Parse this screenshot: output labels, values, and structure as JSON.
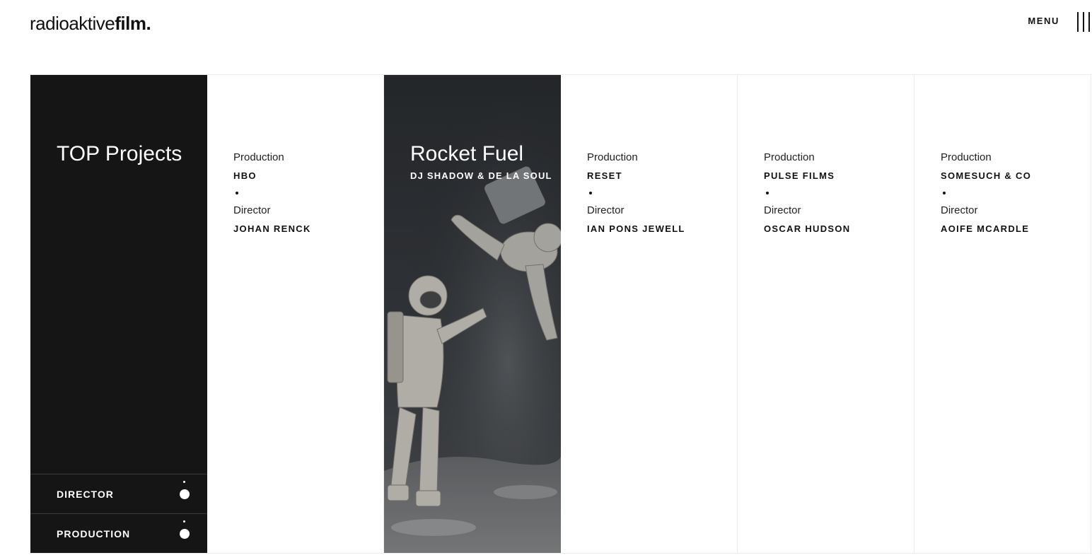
{
  "header": {
    "logo_light": "radioaktive",
    "logo_bold": "film.",
    "menu_label": "MENU"
  },
  "intro": {
    "title": "TOP Projects",
    "filters": [
      {
        "label": "DIRECTOR"
      },
      {
        "label": "PRODUCTION"
      }
    ]
  },
  "projects": [
    {
      "production_label": "Production",
      "production": "HBO",
      "director_label": "Director",
      "director": "JOHAN RENCK"
    },
    {
      "title": "Rocket Fuel",
      "subtitle": "DJ SHADOW & DE LA SOUL"
    },
    {
      "production_label": "Production",
      "production": "RESET",
      "director_label": "Director",
      "director": "IAN PONS JEWELL"
    },
    {
      "production_label": "Production",
      "production": "PULSE FILMS",
      "director_label": "Director",
      "director": "OSCAR HUDSON"
    },
    {
      "production_label": "Production",
      "production": "SOMESUCH & CO",
      "director_label": "Director",
      "director": "AOIFE MCARDLE"
    }
  ],
  "icons": {
    "menu": "menu-bars-icon",
    "filter_toggle": "dot-toggle-icon"
  },
  "colors": {
    "dark_panel": "#151515",
    "text": "#111111",
    "divider": "#ececec"
  }
}
